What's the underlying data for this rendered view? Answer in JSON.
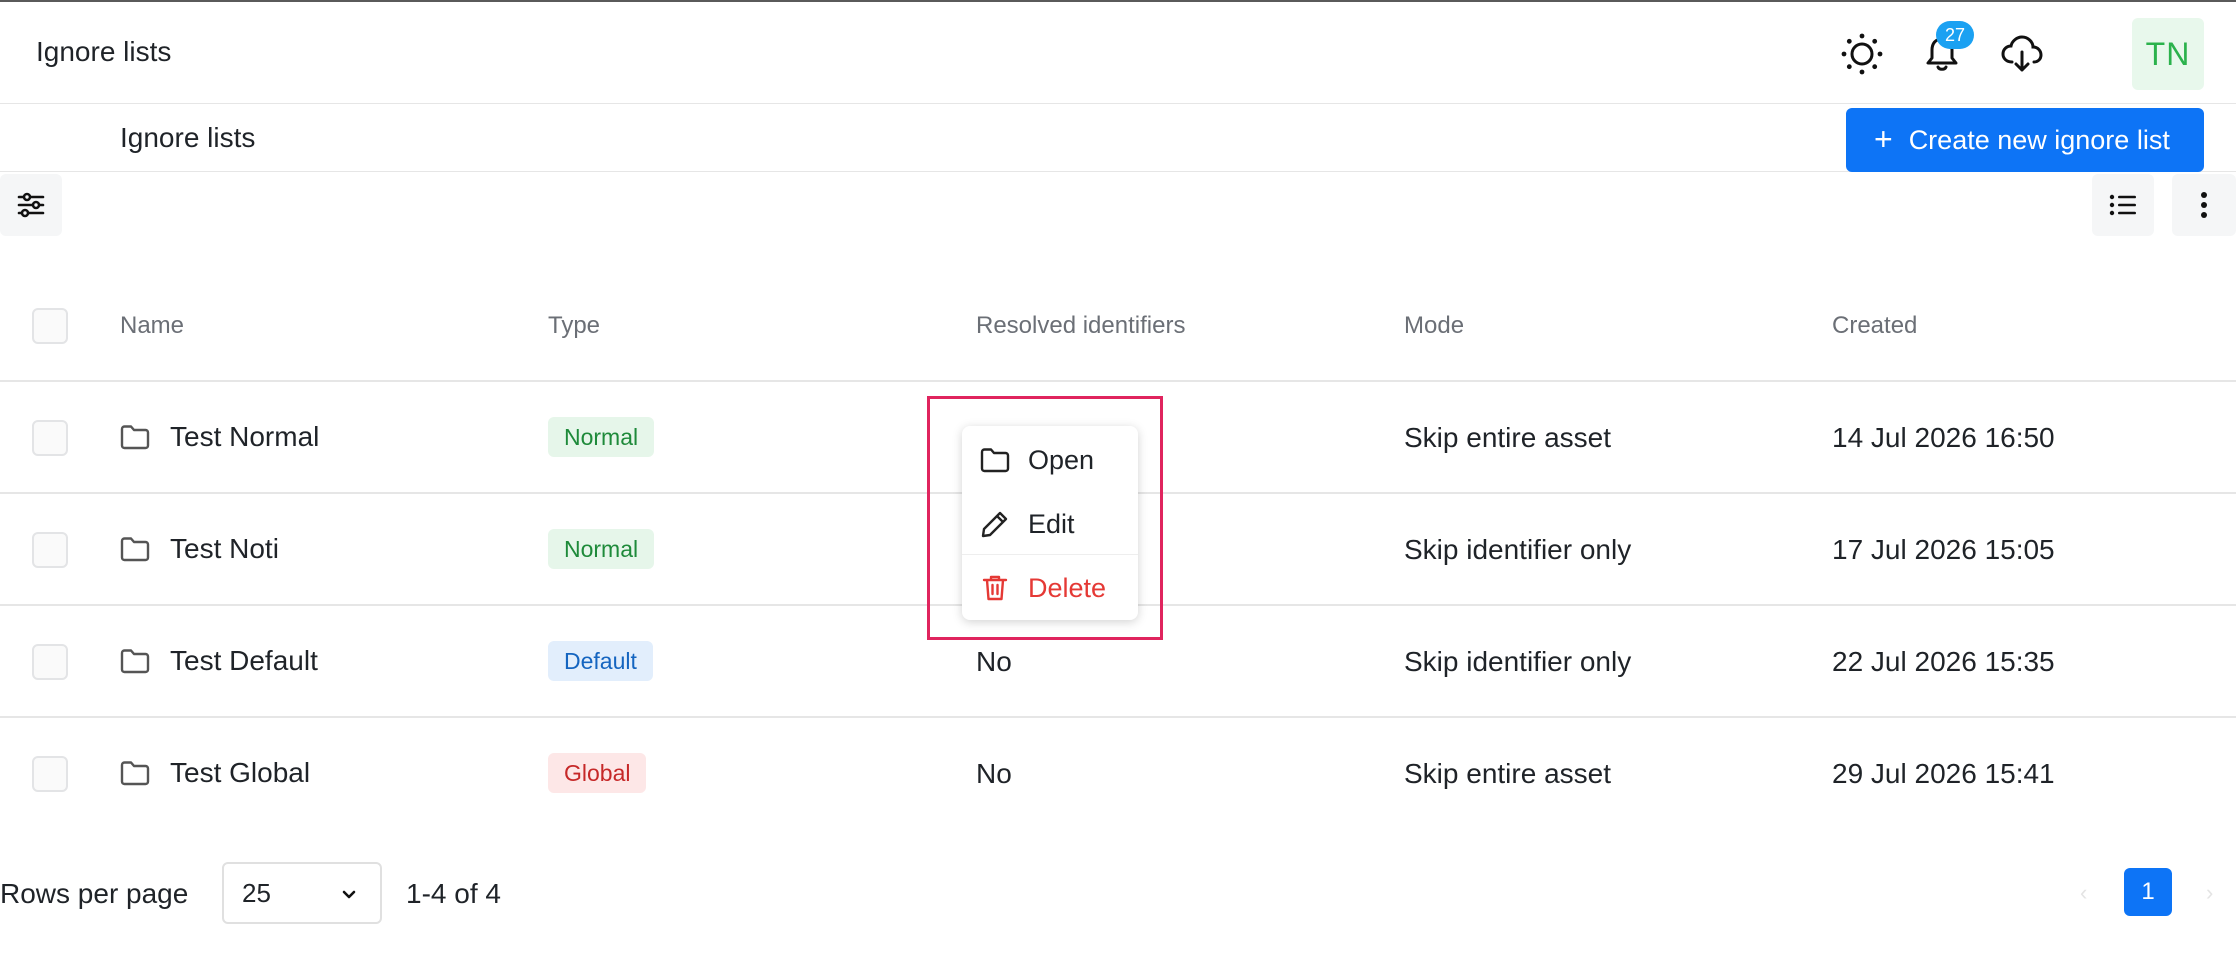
{
  "app": {
    "title": "Ignore lists"
  },
  "header": {
    "icons": [
      "theme-icon",
      "bell-icon",
      "cloud-download-icon"
    ],
    "notification_count": "27",
    "avatar_initials": "TN"
  },
  "page": {
    "title": "Ignore lists",
    "create_button_label": "Create new ignore list",
    "create_button_icon": "+"
  },
  "colors": {
    "accent": "#0d74f6",
    "badge": "#1ba1f2",
    "avatar_bg": "#e8f8ec",
    "avatar_text": "#2bb24c",
    "danger": "#e53935",
    "highlight": "#e0245e"
  },
  "table": {
    "columns": [
      "Name",
      "Type",
      "Resolved identifiers",
      "Mode",
      "Created"
    ],
    "rows": [
      {
        "name": "Test Normal",
        "type": "Normal",
        "resolved": "",
        "mode": "Skip entire asset",
        "created": "14 Jul 2026 16:50"
      },
      {
        "name": "Test Noti",
        "type": "Normal",
        "resolved": "",
        "mode": "Skip identifier only",
        "created": "17 Jul 2026 15:05"
      },
      {
        "name": "Test Default",
        "type": "Default",
        "resolved": "No",
        "mode": "Skip identifier only",
        "created": "22 Jul 2026 15:35"
      },
      {
        "name": "Test Global",
        "type": "Global",
        "resolved": "No",
        "mode": "Skip entire asset",
        "created": "29 Jul 2026 15:41"
      }
    ]
  },
  "context_menu": {
    "items": [
      {
        "label": "Open",
        "icon": "folder-icon"
      },
      {
        "label": "Edit",
        "icon": "pencil-icon"
      },
      {
        "label": "Delete",
        "icon": "trash-icon"
      }
    ]
  },
  "pagination": {
    "rows_per_page_label": "Rows per page",
    "rows_per_page_value": "25",
    "range_text": "1-4 of 4",
    "current_page": "1"
  }
}
